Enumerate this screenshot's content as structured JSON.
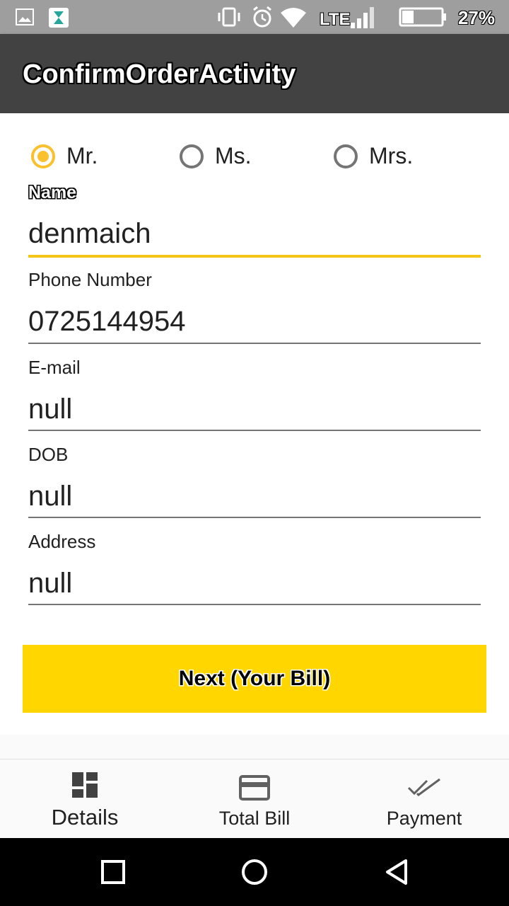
{
  "status_bar": {
    "network": "LTE",
    "battery": "27%"
  },
  "toolbar": {
    "title": "ConfirmOrderActivity"
  },
  "salutation": {
    "options": [
      "Mr.",
      "Ms.",
      "Mrs."
    ],
    "selected": "Mr."
  },
  "form": {
    "name": {
      "label": "Name",
      "value": "denmaich"
    },
    "phone": {
      "label": "Phone Number",
      "value": "0725144954"
    },
    "email": {
      "label": "E-mail",
      "value": "null"
    },
    "dob": {
      "label": "DOB",
      "value": "null"
    },
    "address": {
      "label": "Address",
      "value": "null"
    }
  },
  "next_button": {
    "label": "Next (Your Bill)"
  },
  "bottom_nav": {
    "items": [
      {
        "label": "Details",
        "icon": "dashboard-icon",
        "active": true
      },
      {
        "label": "Total Bill",
        "icon": "credit-card-icon",
        "active": false
      },
      {
        "label": "Payment",
        "icon": "done-all-icon",
        "active": false
      }
    ]
  },
  "colors": {
    "accent": "#fbc02d",
    "button": "#ffd600",
    "toolbar": "#424242",
    "statusbar": "#9e9e9e"
  }
}
